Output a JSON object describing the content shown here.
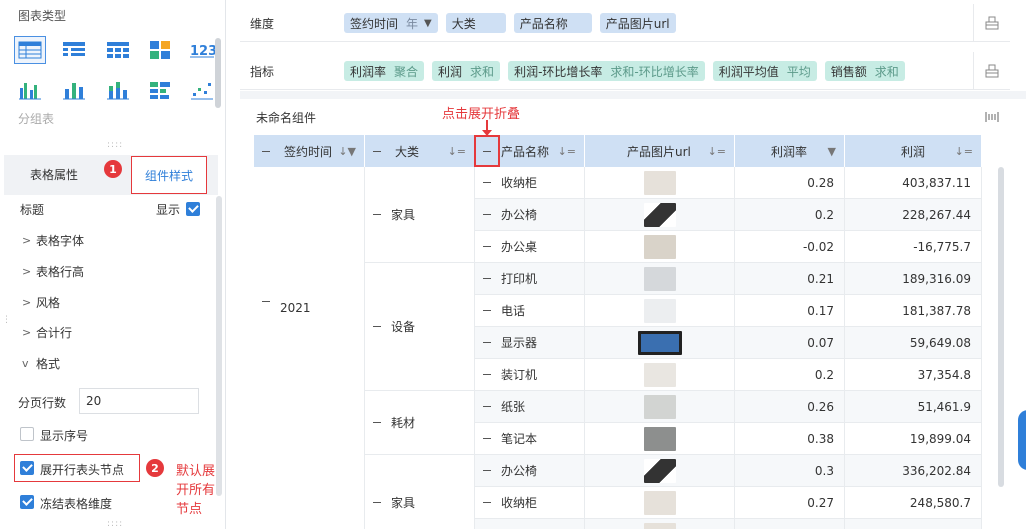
{
  "left": {
    "chart_type_title": "图表类型",
    "group_table_label": "分组表",
    "tabs": {
      "table_attr": "表格属性",
      "component_style": "组件样式"
    },
    "badge1": "1",
    "badge2": "2",
    "title_label": "标题",
    "show_label": "显示",
    "accordion": [
      "表格字体",
      "表格行高",
      "风格",
      "合计行",
      "格式"
    ],
    "page_rows_label": "分页行数",
    "page_rows_value": "20",
    "show_index_label": "显示序号",
    "expand_header_label": "展开行表头节点",
    "freeze_label": "冻结表格维度",
    "note_expand_all": "默认展开所有节点"
  },
  "fields": {
    "dimension_label": "维度",
    "dimensions": [
      {
        "name": "签约时间",
        "sub": "年"
      },
      {
        "name": "大类",
        "sub": ""
      },
      {
        "name": "产品名称",
        "sub": ""
      },
      {
        "name": "产品图片url",
        "sub": ""
      }
    ],
    "indicator_label": "指标",
    "indicators": [
      {
        "name": "利润率",
        "sub": "聚合"
      },
      {
        "name": "利润",
        "sub": "求和"
      },
      {
        "name": "利润-环比增长率",
        "sub": "求和-环比增长率"
      },
      {
        "name": "利润平均值",
        "sub": "平均"
      },
      {
        "name": "销售额",
        "sub": "求和"
      }
    ]
  },
  "table": {
    "component_title": "未命名组件",
    "note_click_expand": "点击展开折叠",
    "headers": [
      "签约时间",
      "大类",
      "产品名称",
      "产品图片url",
      "利润率",
      "利润"
    ],
    "year": "2021",
    "categories": [
      {
        "name": "家具",
        "rows": 3
      },
      {
        "name": "设备",
        "rows": 4
      },
      {
        "name": "耗材",
        "rows": 2
      },
      {
        "name": "家具",
        "rows": 3
      }
    ],
    "rows": [
      {
        "product": "收纳柜",
        "rate": "0.28",
        "profit": "403,837.11",
        "img": "cabinet"
      },
      {
        "product": "办公椅",
        "rate": "0.2",
        "profit": "228,267.44",
        "img": "chair"
      },
      {
        "product": "办公桌",
        "rate": "-0.02",
        "profit": "-16,775.7",
        "img": "desk"
      },
      {
        "product": "打印机",
        "rate": "0.21",
        "profit": "189,316.09",
        "img": "printer"
      },
      {
        "product": "电话",
        "rate": "0.17",
        "profit": "181,387.78",
        "img": "phone"
      },
      {
        "product": "显示器",
        "rate": "0.07",
        "profit": "59,649.08",
        "img": "monitor"
      },
      {
        "product": "装订机",
        "rate": "0.2",
        "profit": "37,354.8",
        "img": "binder"
      },
      {
        "product": "纸张",
        "rate": "0.26",
        "profit": "51,461.9",
        "img": "paper"
      },
      {
        "product": "笔记本",
        "rate": "0.38",
        "profit": "19,899.04",
        "img": "notebook"
      },
      {
        "product": "办公椅",
        "rate": "0.3",
        "profit": "336,202.84",
        "img": "chair"
      },
      {
        "product": "收纳柜",
        "rate": "0.27",
        "profit": "248,580.7",
        "img": "cabinet"
      },
      {
        "product": "",
        "rate": "",
        "profit": "",
        "img": "cabinet"
      }
    ]
  }
}
